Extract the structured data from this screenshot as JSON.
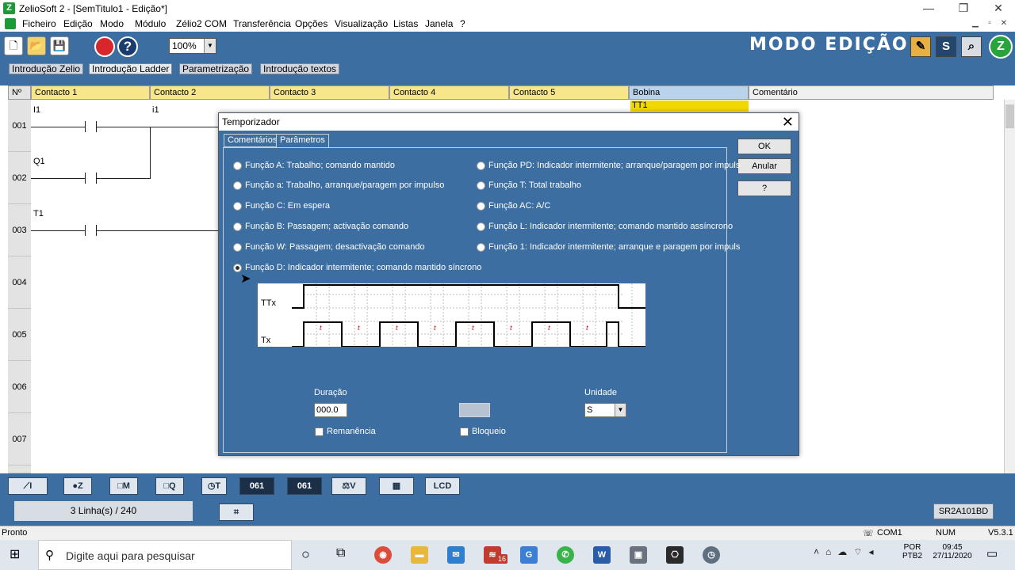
{
  "window": {
    "title": "ZelioSoft 2 - [SemTitulo1 - Edição*]",
    "minimize": "—",
    "restore": "❐",
    "close": "✕"
  },
  "menu": [
    "Ficheiro",
    "Edição",
    "Modo",
    "Módulo",
    "Zélio2 COM",
    "Transferência",
    "Opções",
    "Visualização",
    "Listas",
    "Janela",
    "?"
  ],
  "toolbar": {
    "zoom": "100%",
    "mode_label": "MODO EDIÇÃO",
    "s_label": "S"
  },
  "view_tabs": [
    "Introdução Zelio",
    "Introdução Ladder",
    "Parametrização",
    "Introdução textos"
  ],
  "columns": [
    "Nº",
    "Contacto 1",
    "Contacto 2",
    "Contacto 3",
    "Contacto 4",
    "Contacto 5",
    "Bobina",
    "Comentário"
  ],
  "rows": [
    "001",
    "002",
    "003",
    "004",
    "005",
    "006",
    "007"
  ],
  "ladder": {
    "r1c1": "I1",
    "r1c2": "i1",
    "r2c1": "Q1",
    "r3c1": "T1",
    "coil": "TT1"
  },
  "dialog": {
    "title": "Temporizador",
    "tabs": [
      "Comentários",
      "Parâmetros"
    ],
    "buttons": {
      "ok": "OK",
      "cancel": "Anular",
      "help": "?"
    },
    "functions_left": [
      {
        "label": "Função A: Trabalho; comando mantido",
        "selected": false
      },
      {
        "label": "Função a: Trabalho, arranque/paragem por impulso",
        "selected": false
      },
      {
        "label": "Função C: Em espera",
        "selected": false
      },
      {
        "label": "Função B: Passagem; activação comando",
        "selected": false
      },
      {
        "label": "Função W: Passagem; desactivação comando",
        "selected": false
      },
      {
        "label": "Função D: Indicador intermitente; comando mantido síncrono",
        "selected": true
      }
    ],
    "functions_right": [
      {
        "label": "Função PD: Indicador intermitente; arranque/paragem por impuls",
        "selected": false
      },
      {
        "label": "Função T: Total trabalho",
        "selected": false
      },
      {
        "label": "Função AC: A/C",
        "selected": false
      },
      {
        "label": "Função L: Indicador intermitente; comando mantido assíncrono",
        "selected": false
      },
      {
        "label": "Função 1: Indicador intermitente; arranque e paragem por impuls",
        "selected": false
      }
    ],
    "diagram": {
      "ttx": "TTx",
      "tx": "Tx",
      "t": "t"
    },
    "duration_label": "Duração",
    "duration_value": "000.0",
    "unit_label": "Unidade",
    "unit_value": "S",
    "remanence": "Remanência",
    "lock": "Bloqueio"
  },
  "bottom": {
    "lines": "3 Linha(s) / 240",
    "module": "SR2A101BD"
  },
  "status": {
    "ready": "Pronto",
    "com": "COM1",
    "num": "NUM",
    "version": "V5.3.1"
  },
  "taskbar": {
    "search_placeholder": "Digite aqui para pesquisar",
    "lang1": "POR",
    "lang2": "PTB2",
    "time": "09:45",
    "date": "27/11/2020",
    "badge": "16"
  }
}
